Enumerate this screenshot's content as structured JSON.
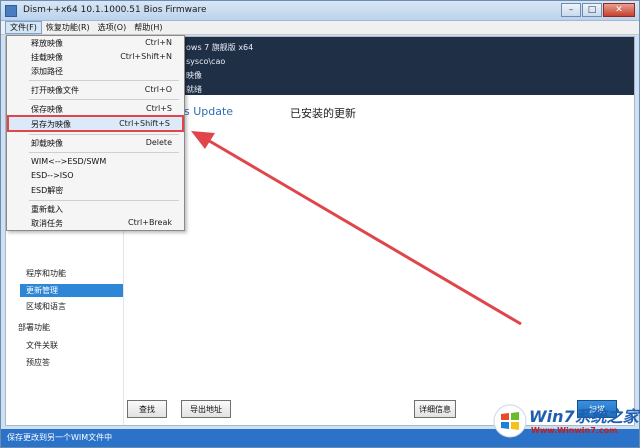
{
  "window": {
    "title": "Dism++x64 10.1.1000.51 Bios Firmware"
  },
  "menubar": {
    "items": [
      "文件(F)",
      "恢复功能(R)",
      "选项(O)",
      "帮助(H)"
    ]
  },
  "header": {
    "lines": [
      "ows 7 旗舰版 x64",
      "sysco\\cao",
      "映像",
      "就绪"
    ]
  },
  "file_menu": {
    "items": [
      {
        "label": "释放映像",
        "shortcut": "Ctrl+N"
      },
      {
        "label": "挂载映像",
        "shortcut": "Ctrl+Shift+N"
      },
      {
        "label": "添加路径",
        "shortcut": ""
      },
      {
        "label": "打开映像文件",
        "shortcut": "Ctrl+O"
      },
      {
        "label": "保存映像",
        "shortcut": "Ctrl+S"
      },
      {
        "label": "另存为映像",
        "shortcut": "Ctrl+Shift+S"
      },
      {
        "label": "卸载映像",
        "shortcut": "Delete"
      },
      {
        "label": "WIM<-->ESD/SWM",
        "shortcut": ""
      },
      {
        "label": "ESD-->ISO",
        "shortcut": ""
      },
      {
        "label": "ESD解密",
        "shortcut": ""
      },
      {
        "label": "重新载入",
        "shortcut": ""
      },
      {
        "label": "取消任务",
        "shortcut": "Ctrl+Break"
      }
    ]
  },
  "leftnav": {
    "items": [
      "程序和功能",
      "更新管理",
      "区域和语言",
      "部署功能",
      "文件关联",
      "预应答"
    ]
  },
  "content": {
    "title": "s Update",
    "subtitle": "已安装的更新",
    "buttons": {
      "find": "查找",
      "export": "导出地址",
      "details": "详细信息",
      "scan": "扫描"
    }
  },
  "statusbar": {
    "text": "保存更改到另一个WIM文件中"
  },
  "watermark": {
    "big": "Win7系统之家",
    "small": "Www.Winwin7.com"
  },
  "colors": {
    "accent": "#2d87d6",
    "highlight_border": "#e0454b",
    "header_bg": "#1f2f46"
  }
}
